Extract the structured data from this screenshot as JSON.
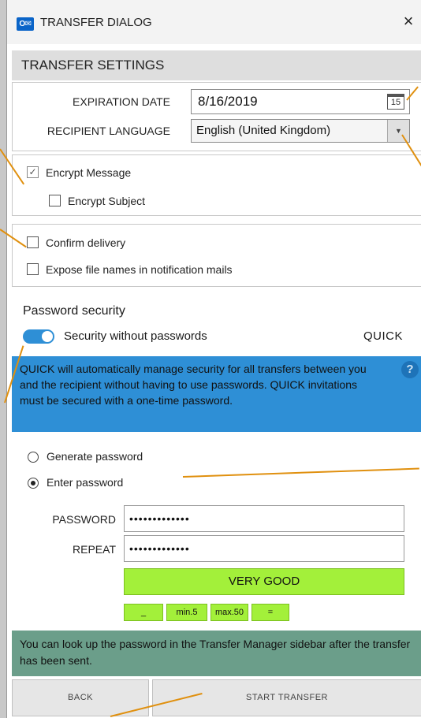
{
  "window": {
    "title": "TRANSFER DIALOG",
    "app_icon_text": "O",
    "close_glyph": "×"
  },
  "section": {
    "title": "TRANSFER SETTINGS"
  },
  "expiration": {
    "label": "EXPIRATION DATE",
    "value": "8/16/2019",
    "calendar_day": "15"
  },
  "language": {
    "label": "RECIPIENT LANGUAGE",
    "value": "English (United Kingdom)",
    "arrow_glyph": "▼"
  },
  "encryption": {
    "encrypt_message": {
      "label": "Encrypt Message",
      "checked": true,
      "mark": "✓"
    },
    "encrypt_subject": {
      "label": "Encrypt Subject",
      "checked": false
    }
  },
  "options": {
    "confirm_delivery": {
      "label": "Confirm delivery",
      "checked": false
    },
    "expose_file_names": {
      "label": "Expose file names in notification mails",
      "checked": false
    }
  },
  "password_security": {
    "heading": "Password security",
    "toggle_label": "Security without passwords",
    "toggle_on": true,
    "mode_badge": "QUICK",
    "info_text": "QUICK will automatically manage security for all transfers between you and the recipient without having to use passwords. QUICK invitations must be secured with a one-time password.",
    "help_glyph": "?"
  },
  "password_mode": {
    "generate_label": "Generate password",
    "enter_label": "Enter password",
    "selected": "enter"
  },
  "password_fields": {
    "password_label": "PASSWORD",
    "password_value": "•••••••••••••",
    "repeat_label": "REPEAT",
    "repeat_value": "•••••••••••••"
  },
  "strength": {
    "label": "VERY GOOD",
    "rules": [
      "_",
      "min.5",
      "max.50",
      "="
    ]
  },
  "note": {
    "text": "You can look up the password in the Transfer Manager sidebar after the transfer has been sent."
  },
  "footer": {
    "back_label": "BACK",
    "start_label": "START TRANSFER"
  },
  "colors": {
    "accent_blue": "#2e8fd6",
    "strength_green": "#a3f03a",
    "note_green": "#6b9e8a",
    "callout_orange": "#e0900f"
  }
}
